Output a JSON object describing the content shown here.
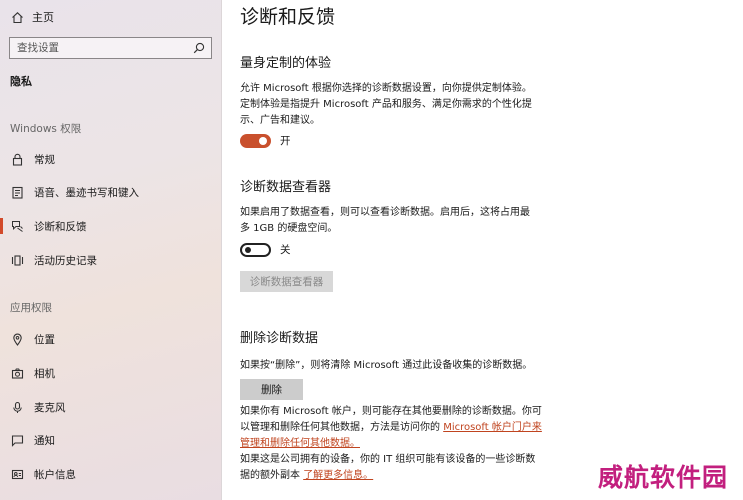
{
  "sidebar": {
    "home_label": "主页",
    "search_placeholder": "查找设置",
    "section_title": "隐私",
    "groups": {
      "windows_permissions": "Windows 权限",
      "app_permissions": "应用权限"
    },
    "windows_items": [
      {
        "label": "常规",
        "icon": "lock-icon"
      },
      {
        "label": "语音、墨迹书写和键入",
        "icon": "notepad-icon"
      },
      {
        "label": "诊断和反馈",
        "icon": "feedback-icon",
        "active": true
      },
      {
        "label": "活动历史记录",
        "icon": "timeline-icon"
      }
    ],
    "app_items": [
      {
        "label": "位置",
        "icon": "location-icon"
      },
      {
        "label": "相机",
        "icon": "camera-icon"
      },
      {
        "label": "麦克风",
        "icon": "microphone-icon"
      },
      {
        "label": "通知",
        "icon": "notification-icon"
      },
      {
        "label": "帐户信息",
        "icon": "account-icon"
      }
    ]
  },
  "main": {
    "title": "诊断和反馈",
    "tailored": {
      "heading": "量身定制的体验",
      "line1": "允许 Microsoft 根据你选择的诊断数据设置，向你提供定制体验。",
      "line2": "定制体验是指提升 Microsoft 产品和服务、满足你需求的个性化提",
      "line3": "示、广告和建议。",
      "toggle_state": "开"
    },
    "viewer": {
      "heading": "诊断数据查看器",
      "line1": "如果启用了数据查看，则可以查看诊断数据。启用后，这将占用最",
      "line2": "多 1GB 的硬盘空间。",
      "toggle_state": "关",
      "button_label": "诊断数据查看器"
    },
    "delete": {
      "heading": "删除诊断数据",
      "line1": "如果按“删除”，则将清除 Microsoft 通过此设备收集的诊断数据。",
      "button_label": "删除",
      "p2_line1": "如果你有 Microsoft 帐户，则可能存在其他要删除的诊断数据。你可",
      "p2_line2_text": "以管理和删除任何其他数据，方法是访问你的 ",
      "p2_link_part1": "Microsoft 帐户门户来",
      "p2_link_part2": "管理和删除任何其他数据。",
      "p3_line1": "如果这是公司拥有的设备，你的 IT 组织可能有该设备的一些诊断数",
      "p3_line2_text": "据的额外副本 ",
      "p3_link": "了解更多信息。"
    }
  },
  "watermark": "威航软件园",
  "colors": {
    "accent": "#c9502d",
    "link": "#c0441f",
    "watermark": "#c21f7e"
  }
}
